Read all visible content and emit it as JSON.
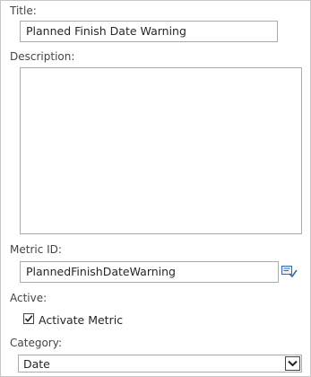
{
  "form": {
    "title_label": "Title:",
    "title_value": "Planned Finish Date Warning",
    "description_label": "Description:",
    "description_value": "",
    "metric_id_label": "Metric ID:",
    "metric_id_value": "PlannedFinishDateWarning",
    "active_label": "Active:",
    "activate_checkbox_label": "Activate Metric",
    "activate_checked": true,
    "category_label": "Category:",
    "category_value": "Date"
  },
  "icons": {
    "picker": "check-names-icon",
    "checkbox_mark": "checkmark-icon",
    "dropdown": "chevron-down-icon"
  },
  "colors": {
    "label_text": "#444444",
    "input_border": "#ababab",
    "picker_blue": "#2a6ebb"
  }
}
